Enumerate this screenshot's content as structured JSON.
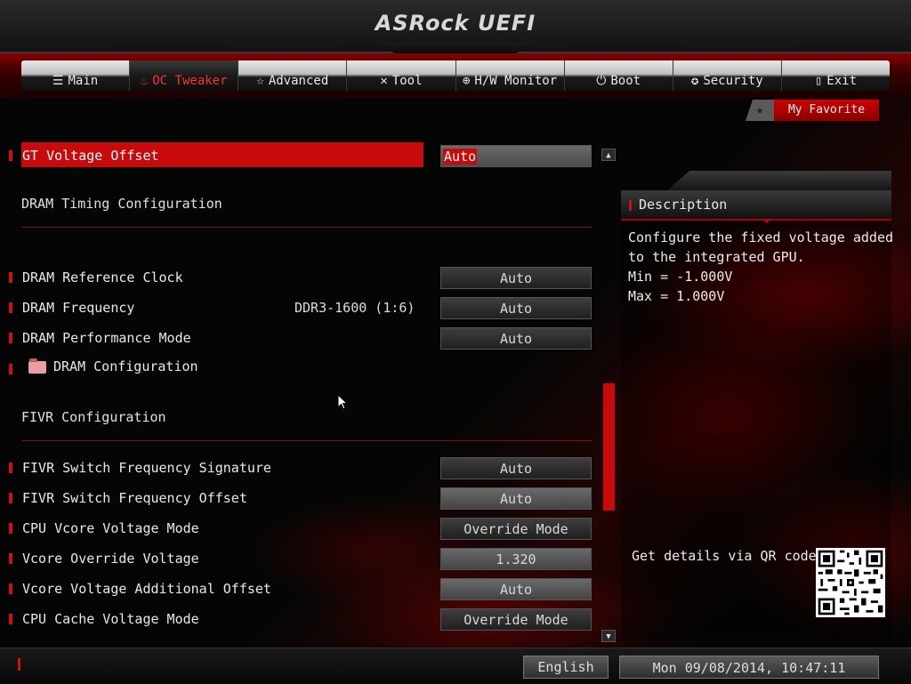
{
  "brand": "ASRock UEFI",
  "nav": {
    "items": [
      {
        "label": "Main",
        "icon": "list-icon",
        "glyph": "☰"
      },
      {
        "label": "OC Tweaker",
        "icon": "flame-icon",
        "glyph": "♨"
      },
      {
        "label": "Advanced",
        "icon": "star-icon",
        "glyph": "☆"
      },
      {
        "label": "Tool",
        "icon": "tools-icon",
        "glyph": "✕"
      },
      {
        "label": "H/W Monitor",
        "icon": "monitor-icon",
        "glyph": "⊕"
      },
      {
        "label": "Boot",
        "icon": "power-icon",
        "glyph": "⏻"
      },
      {
        "label": "Security",
        "icon": "shield-icon",
        "glyph": "✪"
      },
      {
        "label": "Exit",
        "icon": "door-icon",
        "glyph": "▯"
      }
    ],
    "active": "OC Tweaker"
  },
  "favorite": {
    "label": "My Favorite",
    "star": "★"
  },
  "settings": {
    "gt_voltage_offset": {
      "label": "GT Voltage Offset",
      "value": "Auto"
    },
    "dram_timing_section": "DRAM Timing Configuration",
    "dram_reference_clock": {
      "label": "DRAM Reference Clock",
      "value": "Auto"
    },
    "dram_frequency": {
      "label": "DRAM Frequency",
      "info": "DDR3-1600 (1:6)",
      "value": "Auto"
    },
    "dram_performance_mode": {
      "label": "DRAM Performance Mode",
      "value": "Auto"
    },
    "dram_configuration": {
      "label": "DRAM Configuration"
    },
    "fivr_section": "FIVR Configuration",
    "fivr_switch_freq_signature": {
      "label": "FIVR Switch Frequency Signature",
      "value": "Auto"
    },
    "fivr_switch_freq_offset": {
      "label": "FIVR Switch Frequency Offset",
      "value": "Auto"
    },
    "cpu_vcore_voltage_mode": {
      "label": "CPU Vcore Voltage Mode",
      "value": "Override Mode"
    },
    "vcore_override_voltage": {
      "label": "Vcore Override Voltage",
      "value": "1.320"
    },
    "vcore_voltage_additional_offset": {
      "label": "Vcore Voltage Additional Offset",
      "value": "Auto"
    },
    "cpu_cache_voltage_mode": {
      "label": "CPU Cache Voltage Mode",
      "value": "Override Mode"
    }
  },
  "description": {
    "title": "Description",
    "lines": [
      "Configure the fixed voltage added",
      "to the integrated GPU.",
      "Min = -1.000V",
      "Max = 1.000V"
    ],
    "qr_text": "Get details via QR code"
  },
  "footer": {
    "language": "English",
    "datetime": "Mon 09/08/2014, 10:47:11"
  },
  "colors": {
    "accent": "#c80a0a",
    "text": "#e8e8e8",
    "background": "#050505"
  }
}
